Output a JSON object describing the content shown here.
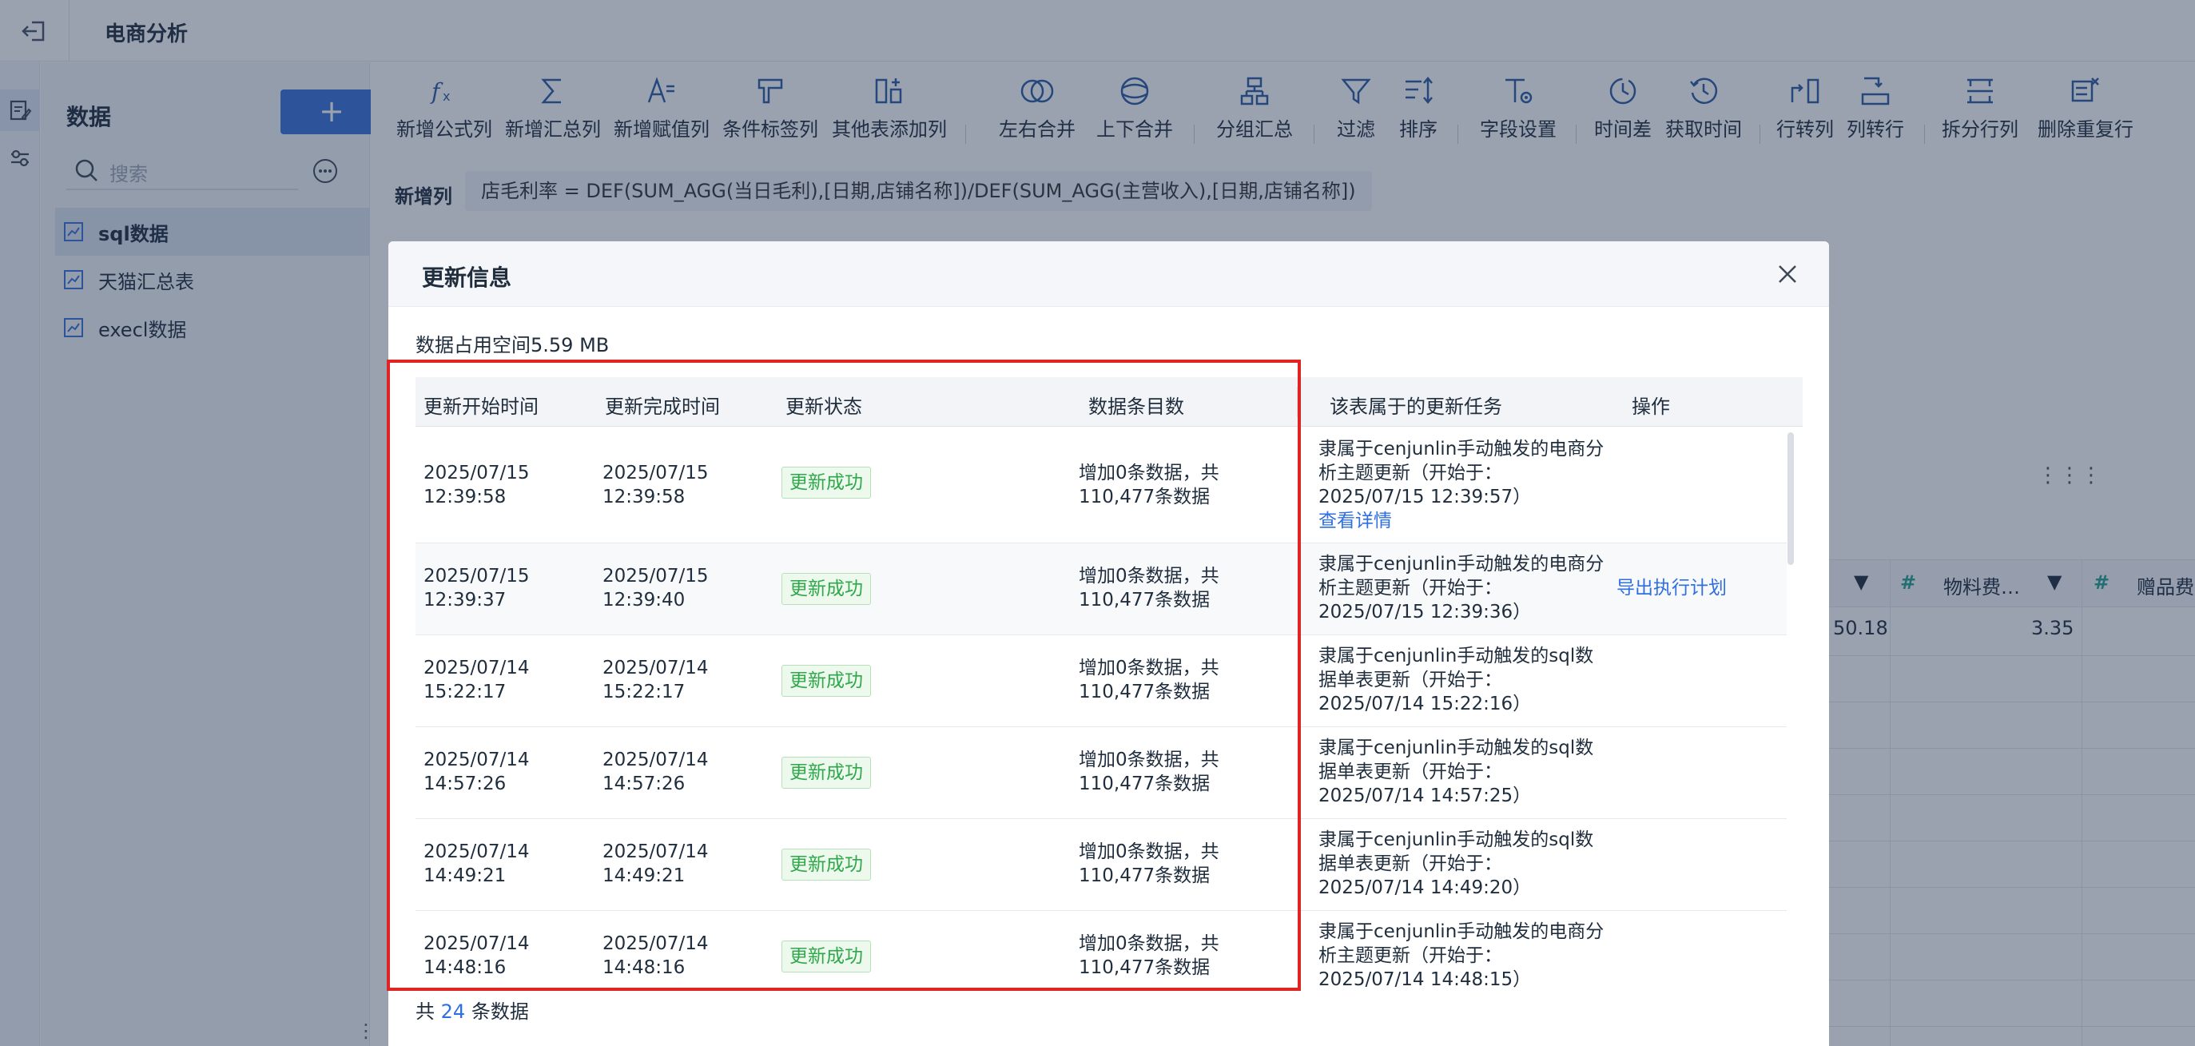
{
  "app": {
    "title": "电商分析"
  },
  "sidebar": {
    "title": "数据",
    "add_label": "+",
    "search_placeholder": "搜索",
    "items": [
      {
        "label": "sql数据",
        "selected": true
      },
      {
        "label": "天猫汇总表",
        "selected": false
      },
      {
        "label": "execl数据",
        "selected": false
      }
    ]
  },
  "toolbar": {
    "items": [
      {
        "label": "新增公式列",
        "icon": "formula-icon"
      },
      {
        "label": "新增汇总列",
        "icon": "sum-icon"
      },
      {
        "label": "新增赋值列",
        "icon": "assign-icon"
      },
      {
        "label": "条件标签列",
        "icon": "condition-tag-icon"
      },
      {
        "label": "其他表添加列",
        "icon": "add-column-icon"
      },
      {
        "label": "左右合并",
        "icon": "merge-lr-icon"
      },
      {
        "label": "上下合并",
        "icon": "merge-ud-icon"
      },
      {
        "label": "分组汇总",
        "icon": "group-summary-icon"
      },
      {
        "label": "过滤",
        "icon": "filter-icon"
      },
      {
        "label": "排序",
        "icon": "sort-icon"
      },
      {
        "label": "字段设置",
        "icon": "field-settings-icon"
      },
      {
        "label": "时间差",
        "icon": "time-diff-icon"
      },
      {
        "label": "获取时间",
        "icon": "get-time-icon"
      },
      {
        "label": "行转列",
        "icon": "row-to-col-icon"
      },
      {
        "label": "列转行",
        "icon": "col-to-row-icon"
      },
      {
        "label": "拆分行列",
        "icon": "split-icon"
      },
      {
        "label": "删除重复行",
        "icon": "dedupe-icon"
      }
    ]
  },
  "formula": {
    "label": "新增列",
    "expression": "店毛利率 = DEF(SUM_AGG(当日毛利),[日期,店铺名称])/DEF(SUM_AGG(主营收入),[日期,店铺名称])"
  },
  "background_grid": {
    "headers": [
      "物料费…",
      "赠品费"
    ],
    "values": [
      "50.18",
      "3.35"
    ]
  },
  "dialog": {
    "title": "更新信息",
    "space_label": "数据占用空间5.59 MB",
    "columns": [
      "更新开始时间",
      "更新完成时间",
      "更新状态",
      "数据条目数",
      "该表属于的更新任务",
      "操作"
    ],
    "rows": [
      {
        "start": "2025/07/15 12:39:58",
        "end": "2025/07/15 12:39:58",
        "status": "更新成功",
        "count": "增加0条数据，共110,477条数据",
        "task": "隶属于cenjunlin手动触发的电商分析主题更新（开始于：2025/07/15 12:39:57）",
        "task_link": "查看详情",
        "action": ""
      },
      {
        "start": "2025/07/15 12:39:37",
        "end": "2025/07/15 12:39:40",
        "status": "更新成功",
        "count": "增加0条数据，共110,477条数据",
        "task": "隶属于cenjunlin手动触发的电商分析主题更新（开始于：2025/07/15 12:39:36）",
        "task_link": "",
        "action": "导出执行计划"
      },
      {
        "start": "2025/07/14 15:22:17",
        "end": "2025/07/14 15:22:17",
        "status": "更新成功",
        "count": "增加0条数据，共110,477条数据",
        "task": "隶属于cenjunlin手动触发的sql数据单表更新（开始于：2025/07/14 15:22:16）",
        "task_link": "",
        "action": ""
      },
      {
        "start": "2025/07/14 14:57:26",
        "end": "2025/07/14 14:57:26",
        "status": "更新成功",
        "count": "增加0条数据，共110,477条数据",
        "task": "隶属于cenjunlin手动触发的sql数据单表更新（开始于：2025/07/14 14:57:25）",
        "task_link": "",
        "action": ""
      },
      {
        "start": "2025/07/14 14:49:21",
        "end": "2025/07/14 14:49:21",
        "status": "更新成功",
        "count": "增加0条数据，共110,477条数据",
        "task": "隶属于cenjunlin手动触发的sql数据单表更新（开始于：2025/07/14 14:49:20）",
        "task_link": "",
        "action": ""
      },
      {
        "start": "2025/07/14 14:48:16",
        "end": "2025/07/14 14:48:16",
        "status": "更新成功",
        "count": "增加0条数据，共110,477条数据",
        "task": "隶属于cenjunlin手动触发的电商分析主题更新（开始于：2025/07/14 14:48:15）",
        "task_link": "",
        "action": ""
      }
    ],
    "footer_prefix": "共",
    "footer_total": "24",
    "footer_suffix": "条数据"
  },
  "colors": {
    "accent": "#3a6fd8",
    "success": "#2ea84a",
    "highlight": "#e02424",
    "link": "#2f6fe0"
  }
}
